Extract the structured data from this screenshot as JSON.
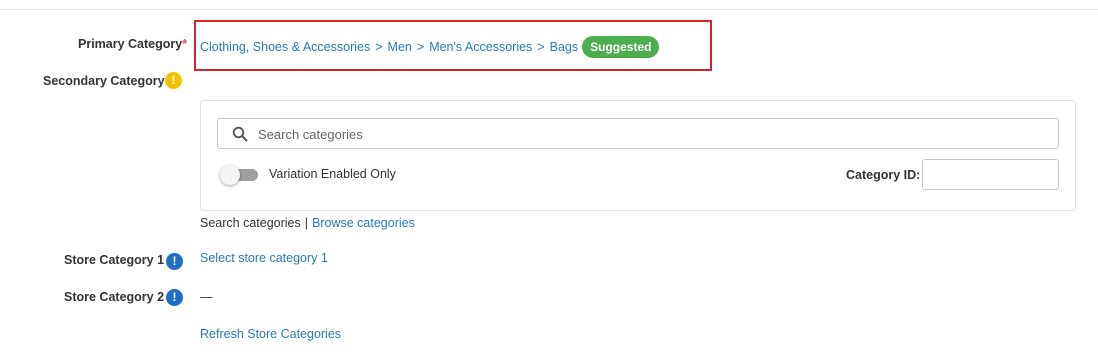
{
  "primary_category": {
    "label": "Primary Category",
    "required_marker": "*",
    "path": [
      "Clothing, Shoes & Accessories",
      "Men",
      "Men's Accessories",
      "Bags"
    ],
    "separator": ">",
    "badge": "Suggested",
    "badge_color": "#4cae4c",
    "highlight_color": "#d8232a"
  },
  "secondary_category": {
    "label": "Secondary Category",
    "warning_icon": "warning-icon",
    "warning_glyph": "!",
    "search": {
      "placeholder": "Search categories",
      "value": ""
    },
    "toggle": {
      "label": "Variation Enabled Only",
      "on": false
    },
    "category_id": {
      "label": "Category ID:",
      "value": ""
    },
    "modes": {
      "current": "Search categories",
      "separator": "|",
      "alternate": "Browse categories"
    }
  },
  "store_category_1": {
    "label": "Store Category 1",
    "info_glyph": "!",
    "link": "Select store category 1"
  },
  "store_category_2": {
    "label": "Store Category 2",
    "info_glyph": "!",
    "value": "—"
  },
  "refresh_link": "Refresh Store Categories",
  "colors": {
    "link": "#2a7ab8",
    "info_icon": "#1f6fc5",
    "warning_icon": "#f2c200"
  }
}
